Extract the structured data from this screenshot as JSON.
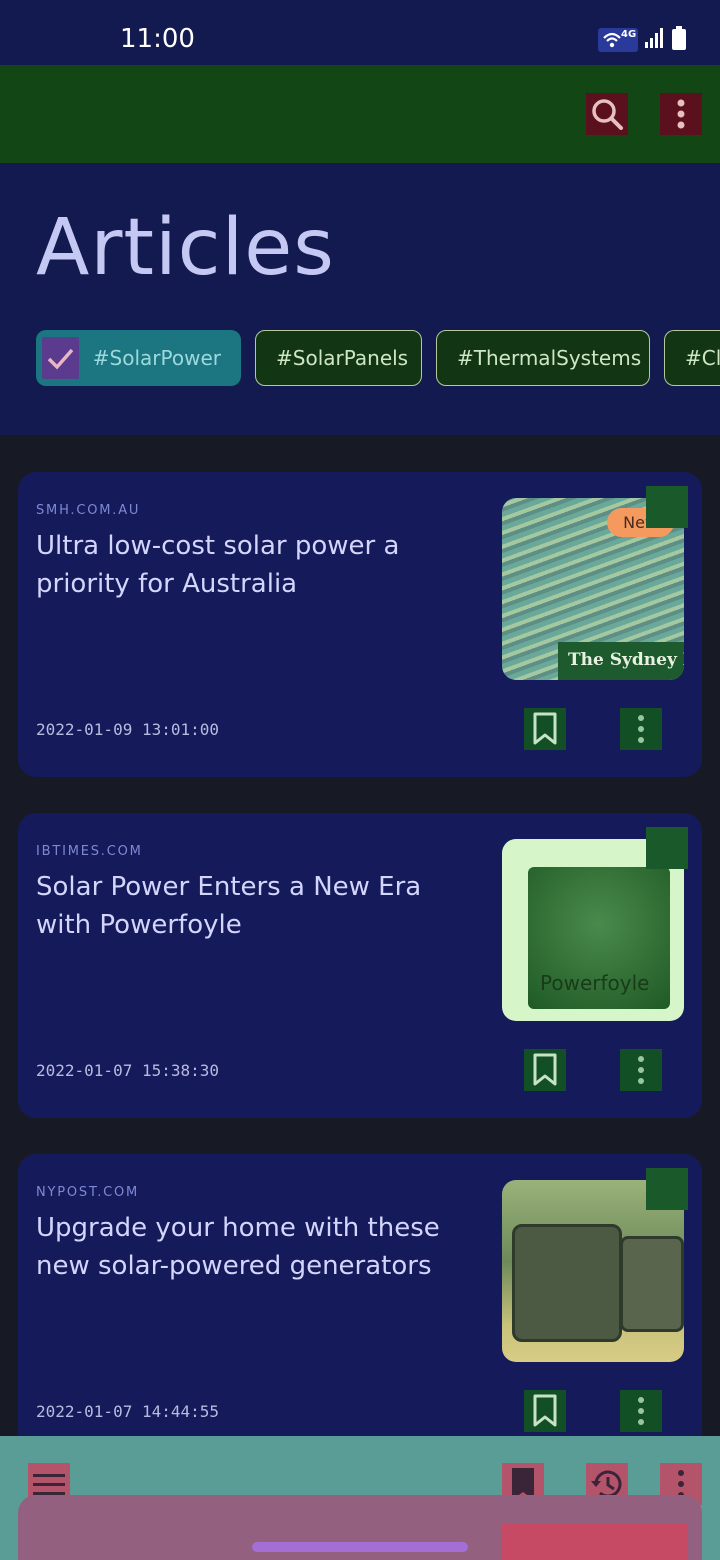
{
  "status_bar": {
    "time": "11:00",
    "network": "4G",
    "icons": [
      "wifi-icon",
      "cellular-signal-icon",
      "battery-icon"
    ]
  },
  "toolbar": {
    "icons": [
      "search-icon",
      "more-vert-icon"
    ]
  },
  "header": {
    "title": "Articles"
  },
  "filters": {
    "chips": [
      {
        "label": "#SolarPower",
        "selected": true
      },
      {
        "label": "#SolarPanels",
        "selected": false
      },
      {
        "label": "#ThermalSystems",
        "selected": false
      },
      {
        "label": "#Cli",
        "selected": false
      }
    ]
  },
  "articles": [
    {
      "source": "SMH.COM.AU",
      "title": "Ultra low-cost solar power a priority for Australia",
      "date": "2022-01-09 13:01:00",
      "badge": "New",
      "thumb_caption": "The Sydney Morn"
    },
    {
      "source": "IBTIMES.COM",
      "title": "Solar Power Enters a New Era with Powerfoyle",
      "date": "2022-01-07 15:38:30",
      "thumb_caption": "Powerfoyle"
    },
    {
      "source": "NYPOST.COM",
      "title": "Upgrade your home with these new solar-powered generators",
      "date": "2022-01-07 14:44:55"
    }
  ],
  "bottom_bar": {
    "icons": [
      "menu-icon",
      "bookmark-icon",
      "history-icon",
      "more-vert-icon"
    ]
  },
  "colors": {
    "header_bg": "#121a4f",
    "toolbar_bg": "#124614",
    "card_bg": "#141a5a",
    "selected_chip": "#1b7682",
    "badge": "#f49a5e"
  }
}
